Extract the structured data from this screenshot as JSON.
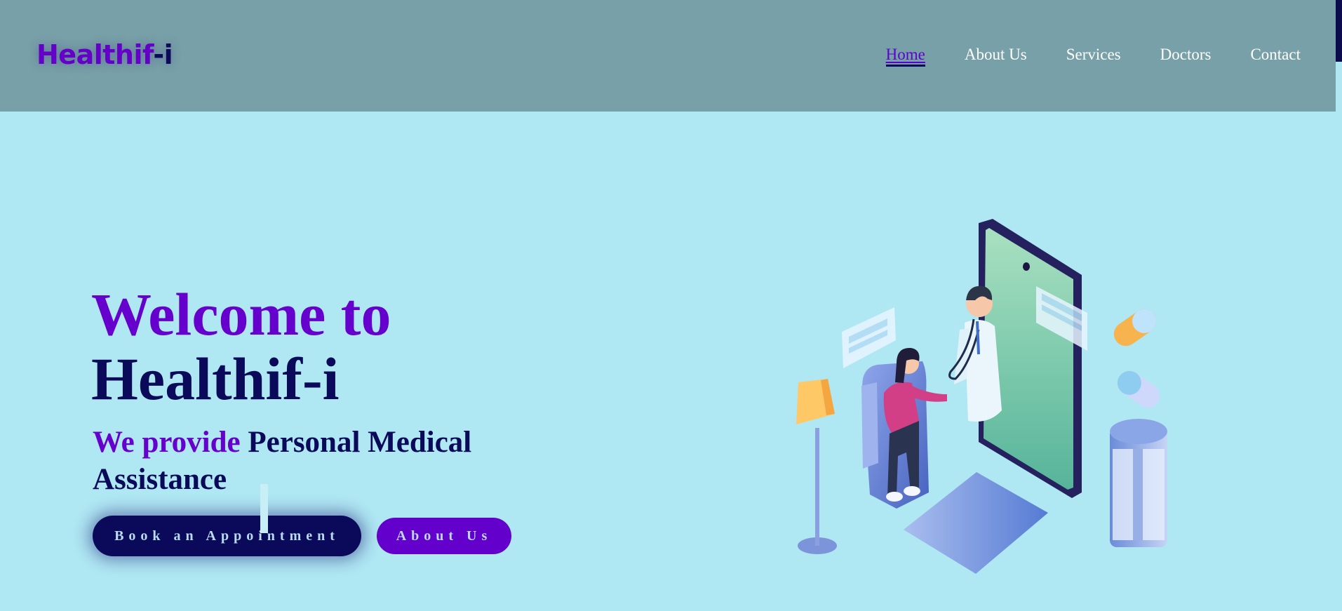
{
  "header": {
    "logo_part1": "Healthif",
    "logo_part2": "-i",
    "nav": [
      {
        "label": "Home",
        "active": true
      },
      {
        "label": "About Us",
        "active": false
      },
      {
        "label": "Services",
        "active": false
      },
      {
        "label": "Doctors",
        "active": false
      },
      {
        "label": "Contact",
        "active": false
      }
    ]
  },
  "hero": {
    "title_line1": "Welcome to",
    "title_line2": "Healthif-i",
    "tagline_part1": "We provide",
    "tagline_part2": " Personal Medical Assistance",
    "buttons": {
      "book": "Book an Appointment",
      "about": "About Us"
    }
  },
  "colors": {
    "header_bg": "#78a0a8",
    "page_bg": "#afe7f3",
    "purple": "#6600cc",
    "navy": "#0b0a5a"
  },
  "icons": {
    "illustration": "doctor-patient-phone-illustration"
  }
}
